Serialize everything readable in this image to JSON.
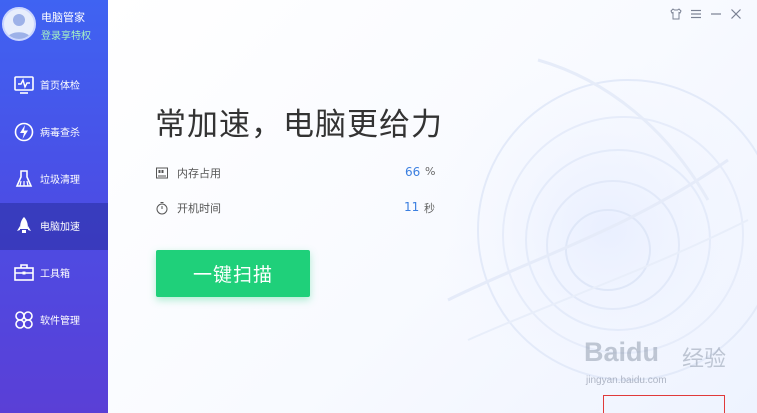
{
  "app": {
    "name": "电脑管家",
    "privilege_link": "登录享特权"
  },
  "sidebar": {
    "items": [
      {
        "label": "首页体检",
        "icon": "monitor-check-icon",
        "active": false
      },
      {
        "label": "病毒查杀",
        "icon": "lightning-shield-icon",
        "active": false
      },
      {
        "label": "垃圾清理",
        "icon": "broom-icon",
        "active": false
      },
      {
        "label": "电脑加速",
        "icon": "rocket-icon",
        "active": true
      },
      {
        "label": "工具箱",
        "icon": "toolbox-icon",
        "active": false
      },
      {
        "label": "软件管理",
        "icon": "software-cube-icon",
        "active": false
      }
    ]
  },
  "window_controls": [
    {
      "name": "skin-icon",
      "glyph": "shirt"
    },
    {
      "name": "menu-icon",
      "glyph": "menu"
    },
    {
      "name": "minimize-icon",
      "glyph": "minimize"
    },
    {
      "name": "close-icon",
      "glyph": "close"
    }
  ],
  "main": {
    "headline": "常加速，电脑更给力",
    "stats": {
      "memory": {
        "label": "内存占用",
        "value": "66",
        "unit": "%"
      },
      "boot": {
        "label": "开机时间",
        "value": "11",
        "unit": "秒"
      }
    },
    "scan_button": "一键扫描"
  },
  "watermark": {
    "logo": "Baidu",
    "cn": "经验",
    "url": "jingyan.baidu.com"
  },
  "colors": {
    "sidebar_top": "#3f63f2",
    "sidebar_bottom": "#5a3fd6",
    "accent_green": "#1fd07a",
    "value_blue": "#3b7fe0",
    "highlight_red": "#e03a3a"
  }
}
